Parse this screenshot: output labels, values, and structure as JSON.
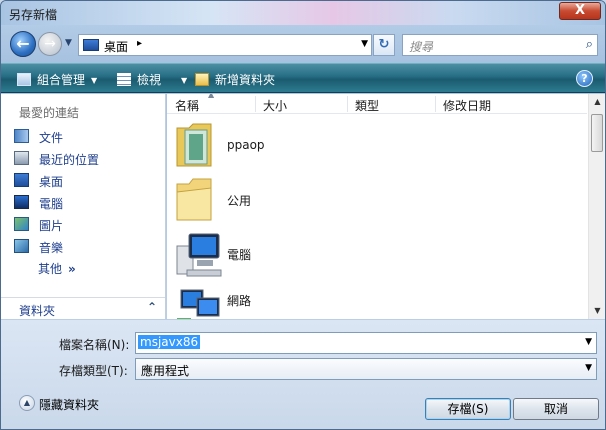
{
  "window": {
    "title": "另存新檔",
    "close_label": "X"
  },
  "nav": {
    "address_location": "桌面",
    "address_separator": "▸",
    "search_placeholder": "搜尋"
  },
  "toolbar": {
    "organize": "組合管理",
    "views": "檢視",
    "new_folder": "新增資料夾",
    "help": "?"
  },
  "navpane": {
    "heading": "最愛的連結",
    "links": [
      "文件",
      "最近的位置",
      "桌面",
      "電腦",
      "圖片",
      "音樂"
    ],
    "more": "其他",
    "more_arrow": "»",
    "folders_label": "資料夾"
  },
  "filelist": {
    "columns": [
      "名稱",
      "大小",
      "類型",
      "修改日期"
    ],
    "items": [
      {
        "name": "ppaop",
        "icon": "folder-file-icon"
      },
      {
        "name": "公用",
        "icon": "folder-icon"
      },
      {
        "name": "電腦",
        "icon": "computer-icon"
      },
      {
        "name": "網路",
        "icon": "network-icon"
      }
    ]
  },
  "form": {
    "filename_label": "檔案名稱(N):",
    "filename_value": "msjavx86",
    "filetype_label": "存檔類型(T):",
    "filetype_value": "應用程式",
    "hide_folders": "隱藏資料夾",
    "save": "存檔(S)",
    "cancel": "取消"
  },
  "colors": {
    "toolbar": "#256c83",
    "link_text": "#1f3f8e",
    "selection": "#3399ff"
  }
}
